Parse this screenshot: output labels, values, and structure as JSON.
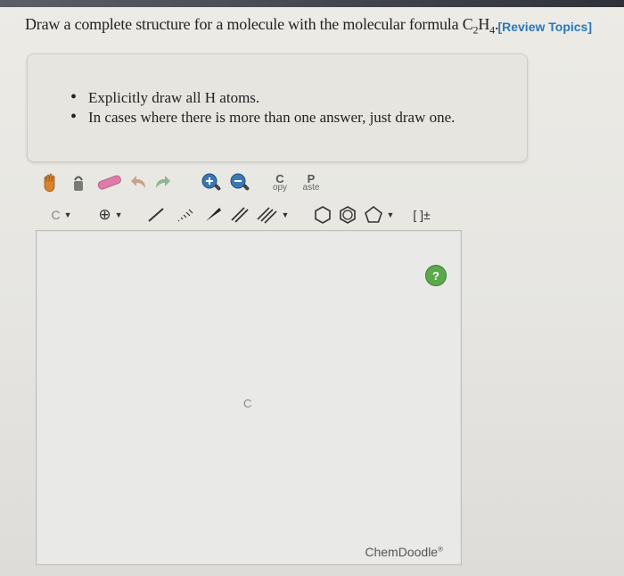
{
  "header": {
    "review_link": "[Review Topics]"
  },
  "question": {
    "prefix": "Draw a complete structure for a molecule with the molecular formula ",
    "formula_c": "C",
    "formula_c_sub": "2",
    "formula_h": "H",
    "formula_h_sub": "4",
    "suffix": "."
  },
  "hints": [
    "Explicitly draw all H atoms.",
    "In cases where there is more than one answer, just draw one."
  ],
  "toolbar": {
    "copy_big": "C",
    "copy_small": "opy",
    "paste_big": "P",
    "paste_small": "aste",
    "element_selector": "C",
    "charge_symbol": "⊕",
    "bracket_label": "[ ]±"
  },
  "canvas": {
    "atom_label": "C",
    "help_label": "?",
    "brand": "ChemDoodle",
    "brand_mark": "®"
  },
  "colors": {
    "link": "#2a78b8",
    "help_green": "#5aa94a"
  }
}
